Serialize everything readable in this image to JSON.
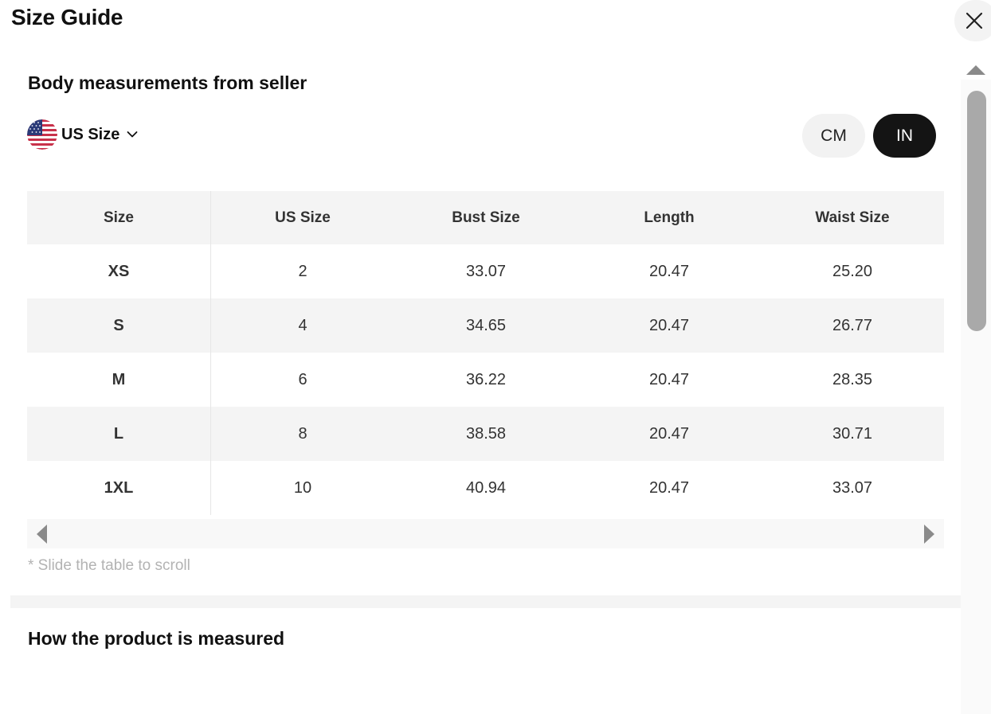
{
  "title": "Size Guide",
  "icons": {
    "close": "close-icon",
    "flag": "us-flag-icon",
    "dropdown": "chevron-down-icon"
  },
  "section1_title": "Body measurements from seller",
  "size_system": {
    "selected": "US Size"
  },
  "units": {
    "cm": "CM",
    "in": "IN",
    "active": "IN"
  },
  "table": {
    "columns": [
      "Size",
      "US Size",
      "Bust Size",
      "Length",
      "Waist Size"
    ],
    "rows": [
      [
        "XS",
        "2",
        "33.07",
        "20.47",
        "25.20"
      ],
      [
        "S",
        "4",
        "34.65",
        "20.47",
        "26.77"
      ],
      [
        "M",
        "6",
        "36.22",
        "20.47",
        "28.35"
      ],
      [
        "L",
        "8",
        "38.58",
        "20.47",
        "30.71"
      ],
      [
        "1XL",
        "10",
        "40.94",
        "20.47",
        "33.07"
      ]
    ]
  },
  "scroll_hint": "* Slide the table to scroll",
  "section2_title": "How the product is measured",
  "colors": {
    "active_toggle": "#141414",
    "row_shade": "#f4f4f4"
  }
}
